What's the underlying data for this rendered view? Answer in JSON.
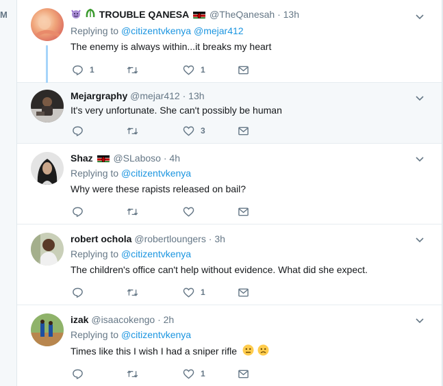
{
  "sidebar": {
    "letter": "M"
  },
  "colors": {
    "link": "#1b95e0",
    "muted": "#657786",
    "thread_line": "#a6d4fa",
    "highlight_bg": "#f5f8fa"
  },
  "tweets": [
    {
      "name": "TROUBLE QANESA",
      "handle": "@TheQanesah",
      "dot": "·",
      "time": "13h",
      "replying_label": "Replying to",
      "reply_to": [
        "@citizentvkenya",
        "@mejar412"
      ],
      "text": "The enemy is always within...it breaks my heart",
      "counts": {
        "reply": "1",
        "retweet": "",
        "like": "1"
      }
    },
    {
      "name": "Mejargraphy",
      "handle": "@mejar412",
      "dot": "·",
      "time": "13h",
      "text": "It's very unfortunate. She can't possibly be human",
      "counts": {
        "reply": "",
        "retweet": "",
        "like": "3"
      }
    },
    {
      "name": "Shaz",
      "handle": "@SLaboso",
      "dot": "·",
      "time": "4h",
      "replying_label": "Replying to",
      "reply_to": [
        "@citizentvkenya"
      ],
      "text": "Why were these rapists released on bail?",
      "counts": {
        "reply": "",
        "retweet": "",
        "like": ""
      }
    },
    {
      "name": "robert ochola",
      "handle": "@robertloungers",
      "dot": "·",
      "time": "3h",
      "replying_label": "Replying to",
      "reply_to": [
        "@citizentvkenya"
      ],
      "text": "The children's office can't help without evidence. What did she expect.",
      "counts": {
        "reply": "",
        "retweet": "",
        "like": "1"
      }
    },
    {
      "name": "izak",
      "handle": "@isaacokengo",
      "dot": "·",
      "time": "2h",
      "replying_label": "Replying to",
      "reply_to": [
        "@citizentvkenya"
      ],
      "text": "Times like this I wish I had a sniper rifle",
      "counts": {
        "reply": "",
        "retweet": "",
        "like": "1"
      }
    }
  ]
}
